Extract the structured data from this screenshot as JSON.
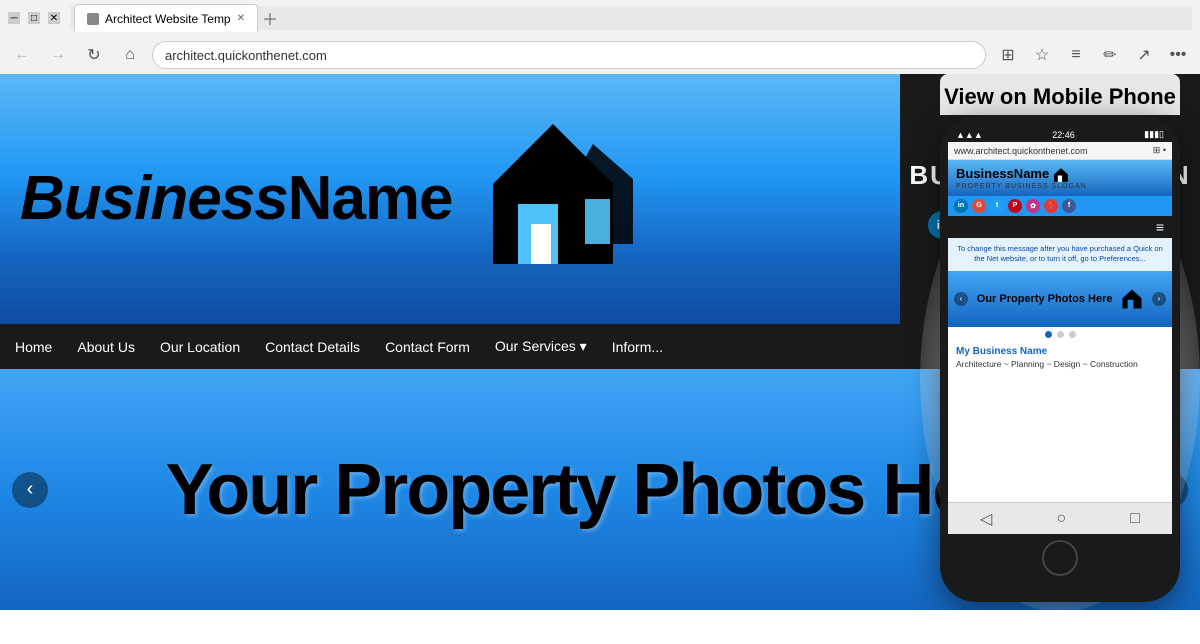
{
  "browser": {
    "tab_title": "Architect Website Temp",
    "url": "architect.quickonthenet.com",
    "favicon": "page"
  },
  "site": {
    "business_name": "BusinessName",
    "business_name_bold": "Business",
    "business_name_rest": "Name",
    "slogan": "BUSINESS SLOGAN",
    "property_slogan": "PROPERTY BUSINESS SLOGAN",
    "nav_items": [
      "Home",
      "About Us",
      "Our Location",
      "Contact Details",
      "Contact Form",
      "Our Services ▾",
      "Inform..."
    ],
    "info_message": "To change this message after you have purchased a Quick on the N...",
    "info_message_full": "To change this message after you have purchased a Quick on the Net website, or to turn it off, go to Preferences...",
    "property_banner_text": "Your Property Photos Here",
    "mobile_label": "View on Mobile Phone",
    "mobile_url": "www.architect.quickonthenet.com",
    "mobile_phone_business_name": "My Business Name",
    "mobile_phone_tagline": "Architecture ~ Planning ~ Design ~ Construction",
    "mobile_phone_property_text": "Our Property Photos Here",
    "mobile_phone_info": "To change this message after you have purchased a Quick on the Net website, or to turn it off, go to Preferences...",
    "mobile_time": "22:46"
  },
  "social_icons": [
    {
      "name": "linkedin",
      "label": "in",
      "class": "si-linkedin"
    },
    {
      "name": "google",
      "label": "G+",
      "class": "si-google"
    },
    {
      "name": "twitter",
      "label": "t",
      "class": "si-twitter"
    },
    {
      "name": "pinterest",
      "label": "P",
      "class": "si-pinterest"
    },
    {
      "name": "instagram",
      "label": "✿",
      "class": "si-instagram"
    },
    {
      "name": "location",
      "label": "📍",
      "class": "si-location"
    },
    {
      "name": "facebook",
      "label": "f",
      "class": "si-facebook"
    }
  ],
  "colors": {
    "bg_gradient_top": "#5bb8f5",
    "bg_gradient_bottom": "#0d47a1",
    "nav_bg": "#1a1a1a",
    "slogan_panel_bg": "#1a1a1a",
    "text_dark": "#000000",
    "text_white": "#ffffff",
    "text_blue": "#0d47a1",
    "info_bg": "#e3f2fd"
  }
}
